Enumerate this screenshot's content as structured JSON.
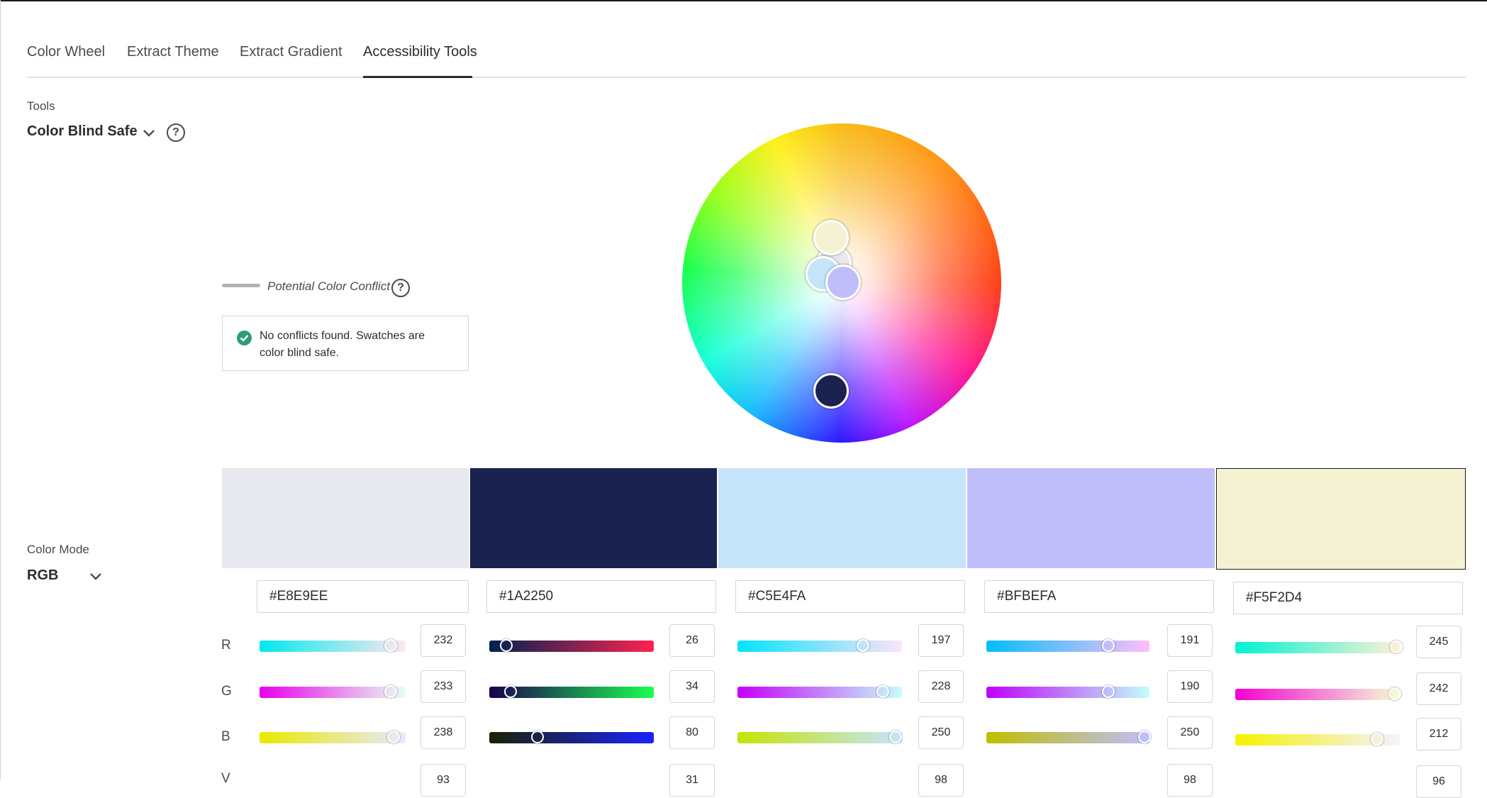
{
  "tabs": [
    {
      "label": "Color Wheel",
      "active": false
    },
    {
      "label": "Extract Theme",
      "active": false
    },
    {
      "label": "Extract Gradient",
      "active": false
    },
    {
      "label": "Accessibility Tools",
      "active": true
    }
  ],
  "tools": {
    "label": "Tools",
    "value": "Color Blind Safe",
    "help_icon": "help-icon"
  },
  "conflict": {
    "legend_label": "Potential Color Conflict",
    "status_text": "No conflicts found. Swatches are color blind safe.",
    "status_icon": "check-circle-icon"
  },
  "color_mode": {
    "label": "Color Mode",
    "value": "RGB"
  },
  "channels": [
    "R",
    "G",
    "B",
    "V"
  ],
  "swatches": [
    {
      "hex": "#E8E9EE",
      "color": "#E8E9EE",
      "r": 232,
      "g": 233,
      "b": 238,
      "v": "93"
    },
    {
      "hex": "#1A2250",
      "color": "#1A2250",
      "r": 26,
      "g": 34,
      "b": 80,
      "v": "31"
    },
    {
      "hex": "#C5E4FA",
      "color": "#C5E4FA",
      "r": 197,
      "g": 228,
      "b": 250,
      "v": "98"
    },
    {
      "hex": "#BFBEFA",
      "color": "#BFBEFA",
      "r": 191,
      "g": 190,
      "b": 250,
      "v": "98"
    },
    {
      "hex": "#F5F2D4",
      "color": "#F5F2D4",
      "r": 245,
      "g": 242,
      "b": 212,
      "v": "96"
    }
  ],
  "active_swatch_index": 4
}
